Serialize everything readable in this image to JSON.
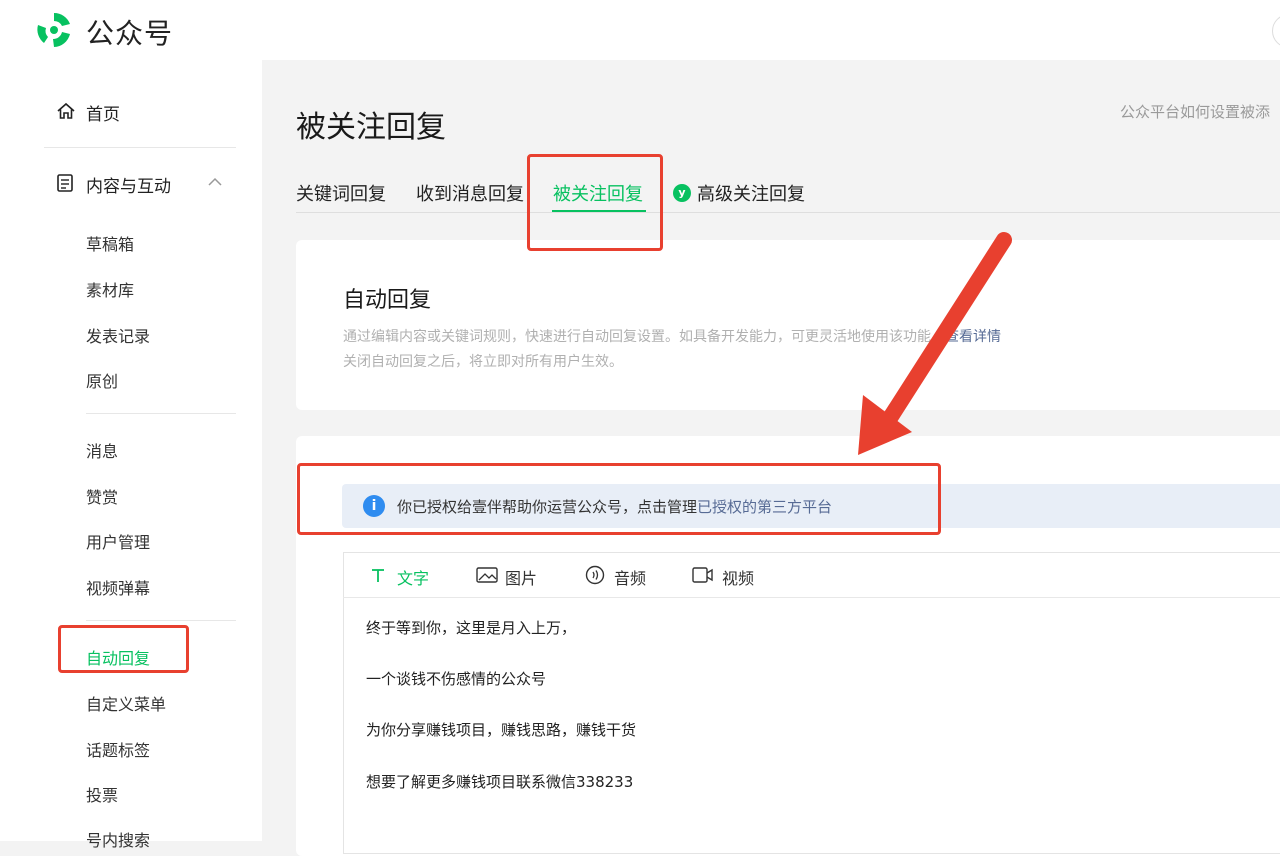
{
  "header": {
    "brand": "公众号",
    "logo_icon": "wechat-official-account-logo"
  },
  "sidebar": {
    "home_label": "首页",
    "content_group_label": "内容与互动",
    "content_items": [
      "草稿箱",
      "素材库",
      "发表记录",
      "原创"
    ],
    "interact_items": [
      "消息",
      "赞赏",
      "用户管理",
      "视频弹幕"
    ],
    "feature_items": [
      "自动回复",
      "自定义菜单",
      "话题标签",
      "投票",
      "号内搜索"
    ],
    "active_item": "自动回复"
  },
  "page": {
    "title": "被关注回复",
    "help_link": "公众平台如何设置被添"
  },
  "tabs": [
    {
      "label": "关键词回复"
    },
    {
      "label": "收到消息回复"
    },
    {
      "label": "被关注回复",
      "active": true
    },
    {
      "label": "高级关注回复",
      "badge": "y"
    }
  ],
  "intro_card": {
    "title": "自动回复",
    "desc_line1": "通过编辑内容或关键词规则，快速进行自动回复设置。如具备开发能力，可更灵活地使用该功能。",
    "desc_link": "查看详情",
    "desc_line2": "关闭自动回复之后，将立即对所有用户生效。"
  },
  "notice": {
    "info_icon": "i",
    "text": "你已授权给壹伴帮助你运营公众号，点击管理",
    "link": "已授权的第三方平台"
  },
  "editor": {
    "tools": [
      {
        "icon": "text-icon",
        "label": "文字",
        "active": true
      },
      {
        "icon": "image-icon",
        "label": "图片"
      },
      {
        "icon": "audio-icon",
        "label": "音频"
      },
      {
        "icon": "video-icon",
        "label": "视频"
      }
    ],
    "lines": [
      "终于等到你，这里是月入上万，",
      "一个谈钱不伤感情的公众号",
      "为你分享赚钱项目，赚钱思路，赚钱干货",
      "想要了解更多赚钱项目联系微信338233"
    ]
  },
  "colors": {
    "accent": "#07c160",
    "annotation": "#e8402f",
    "link": "#576b95"
  }
}
